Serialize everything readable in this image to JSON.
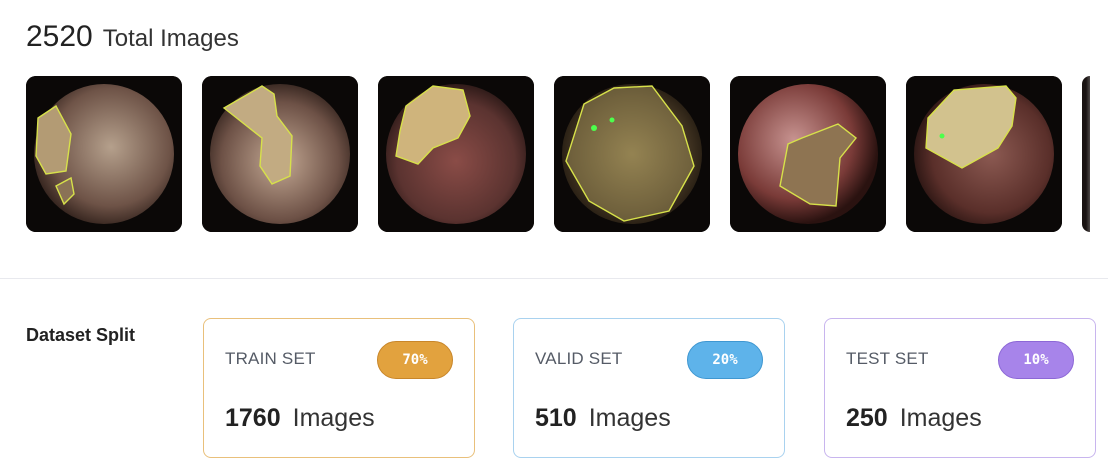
{
  "header": {
    "total_count": "2520",
    "total_label": "Total Images"
  },
  "thumbnails": [
    {
      "name": "image-thumbnail-1",
      "bg": "#7b5c4e",
      "lesion": "#b39b74"
    },
    {
      "name": "image-thumbnail-2",
      "bg": "#6b5045",
      "lesion": "#c2ab82"
    },
    {
      "name": "image-thumbnail-3",
      "bg": "#5b3330",
      "lesion": "#cfb47c"
    },
    {
      "name": "image-thumbnail-4",
      "bg": "#3e3120",
      "lesion": "#9a8a55"
    },
    {
      "name": "image-thumbnail-5",
      "bg": "#7a3b38",
      "lesion": "#8e7452"
    },
    {
      "name": "image-thumbnail-6",
      "bg": "#5a2f2a",
      "lesion": "#d2c28e"
    }
  ],
  "dataset_split": {
    "label": "Dataset Split",
    "train": {
      "title": "TRAIN SET",
      "percent": "70%",
      "count": "1760",
      "unit": "Images",
      "color": "#e2a23e"
    },
    "valid": {
      "title": "VALID SET",
      "percent": "20%",
      "count": "510",
      "unit": "Images",
      "color": "#5eb3ea"
    },
    "test": {
      "title": "TEST SET",
      "percent": "10%",
      "count": "250",
      "unit": "Images",
      "color": "#a784ea"
    }
  }
}
